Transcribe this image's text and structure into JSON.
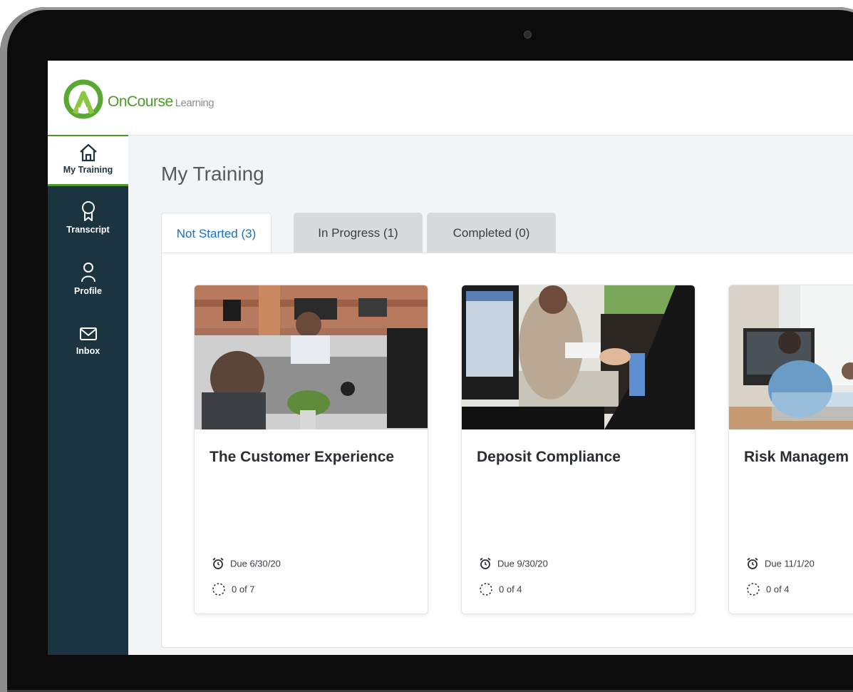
{
  "app": {
    "brand_primary": "OnCourse",
    "brand_secondary": "Learning",
    "brand_color": "#4c9a2a",
    "sidebar_color": "#1c3440"
  },
  "sidebar": {
    "items": [
      {
        "label": "My Training",
        "icon": "home-icon",
        "active": true
      },
      {
        "label": "Transcript",
        "icon": "ribbon-icon",
        "active": false
      },
      {
        "label": "Profile",
        "icon": "user-icon",
        "active": false
      },
      {
        "label": "Inbox",
        "icon": "mail-icon",
        "active": false
      }
    ]
  },
  "main": {
    "title": "My Training",
    "tabs": [
      {
        "label": "Not Started (3)",
        "active": true
      },
      {
        "label": "In Progress (1)",
        "active": false
      },
      {
        "label": "Completed (0)",
        "active": false
      }
    ],
    "courses": [
      {
        "title": "The Customer Experience",
        "due": "Due 6/30/20",
        "progress": "0 of 7",
        "image": "call-center-photo"
      },
      {
        "title": "Deposit Compliance",
        "due": "Due 9/30/20",
        "progress": "0 of 4",
        "image": "bank-teller-photo"
      },
      {
        "title": "Risk Managem",
        "due": "Due 11/1/20",
        "progress": "0 of 4",
        "image": "office-meeting-photo"
      }
    ],
    "accent_color": "#1a6fbf"
  }
}
